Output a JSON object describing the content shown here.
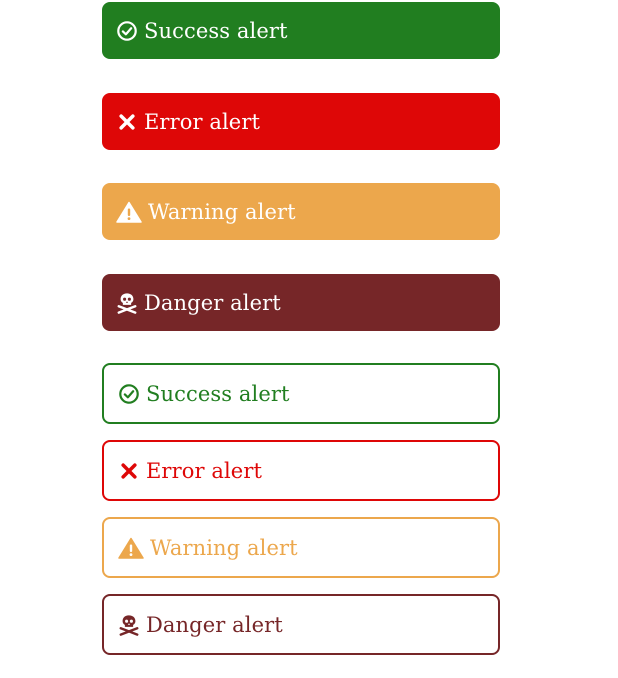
{
  "colors": {
    "success": "#217e20",
    "error": "#de0707",
    "warning": "#eca74c",
    "danger": "#762628"
  },
  "solid_alerts": [
    {
      "type": "success",
      "icon": "check-circle-icon",
      "label": "Success alert"
    },
    {
      "type": "error",
      "icon": "close-icon",
      "label": "Error alert"
    },
    {
      "type": "warning",
      "icon": "warning-triangle-icon",
      "label": "Warning alert"
    },
    {
      "type": "danger",
      "icon": "skull-crossbones-icon",
      "label": "Danger alert"
    }
  ],
  "outline_alerts": [
    {
      "type": "success",
      "icon": "check-circle-icon",
      "label": "Success alert"
    },
    {
      "type": "error",
      "icon": "close-icon",
      "label": "Error alert"
    },
    {
      "type": "warning",
      "icon": "warning-triangle-icon",
      "label": "Warning alert"
    },
    {
      "type": "danger",
      "icon": "skull-crossbones-icon",
      "label": "Danger alert"
    }
  ]
}
